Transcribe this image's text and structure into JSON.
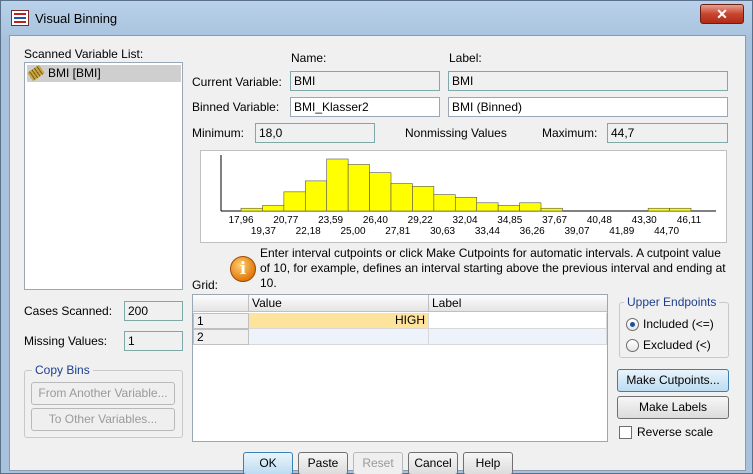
{
  "window": {
    "title": "Visual Binning",
    "close_label": "✕"
  },
  "scanned_list": {
    "label": "Scanned Variable List:",
    "items": [
      "BMI [BMI]"
    ]
  },
  "headers": {
    "name": "Name:",
    "label": "Label:"
  },
  "current_variable": {
    "label": "Current Variable:",
    "name": "BMI",
    "var_label": "BMI"
  },
  "binned_variable": {
    "label": "Binned Variable:",
    "name": "BMI_Klasser2",
    "var_label": "BMI (Binned)"
  },
  "minimum": {
    "label": "Minimum:",
    "value": "18,0"
  },
  "nonmissing": {
    "label": "Nonmissing Values"
  },
  "maximum": {
    "label": "Maximum:",
    "value": "44,7"
  },
  "chart_data": {
    "type": "bar",
    "bar_color": "#ffff00",
    "tick_labels_top": [
      "17,96",
      "20,77",
      "23,59",
      "26,40",
      "29,22",
      "32,04",
      "34,85",
      "37,67",
      "40,48",
      "43,30",
      "46,11"
    ],
    "tick_labels_bottom": [
      "19,37",
      "22,18",
      "25,00",
      "27,81",
      "30,63",
      "33,44",
      "36,26",
      "39,07",
      "41,89",
      "44,70"
    ],
    "values": [
      1,
      2,
      7,
      11,
      19,
      17,
      14,
      10,
      9,
      6,
      5,
      3,
      2,
      3,
      1,
      0,
      0,
      0,
      0,
      1,
      1
    ]
  },
  "info": {
    "icon": "info-icon",
    "text": "Enter interval cutpoints or click Make Cutpoints for automatic intervals. A cutpoint value of 10, for example, defines an interval starting above the previous interval and ending at 10."
  },
  "grid": {
    "label": "Grid:",
    "columns": [
      "Value",
      "Label"
    ],
    "rows": [
      {
        "num": "1",
        "value": "HIGH",
        "label": ""
      },
      {
        "num": "2",
        "value": "",
        "label": ""
      }
    ]
  },
  "cases_scanned": {
    "label": "Cases Scanned:",
    "value": "200"
  },
  "missing_values": {
    "label": "Missing Values:",
    "value": "1"
  },
  "copy_bins": {
    "title": "Copy Bins",
    "from_button": "From Another Variable...",
    "to_button": "To Other Variables..."
  },
  "upper_endpoints": {
    "title": "Upper Endpoints",
    "included": "Included (<=)",
    "excluded": "Excluded (<)"
  },
  "buttons": {
    "make_cutpoints": "Make Cutpoints...",
    "make_labels": "Make Labels",
    "reverse_scale": "Reverse scale",
    "ok": "OK",
    "paste": "Paste",
    "reset": "Reset",
    "cancel": "Cancel",
    "help": "Help"
  }
}
